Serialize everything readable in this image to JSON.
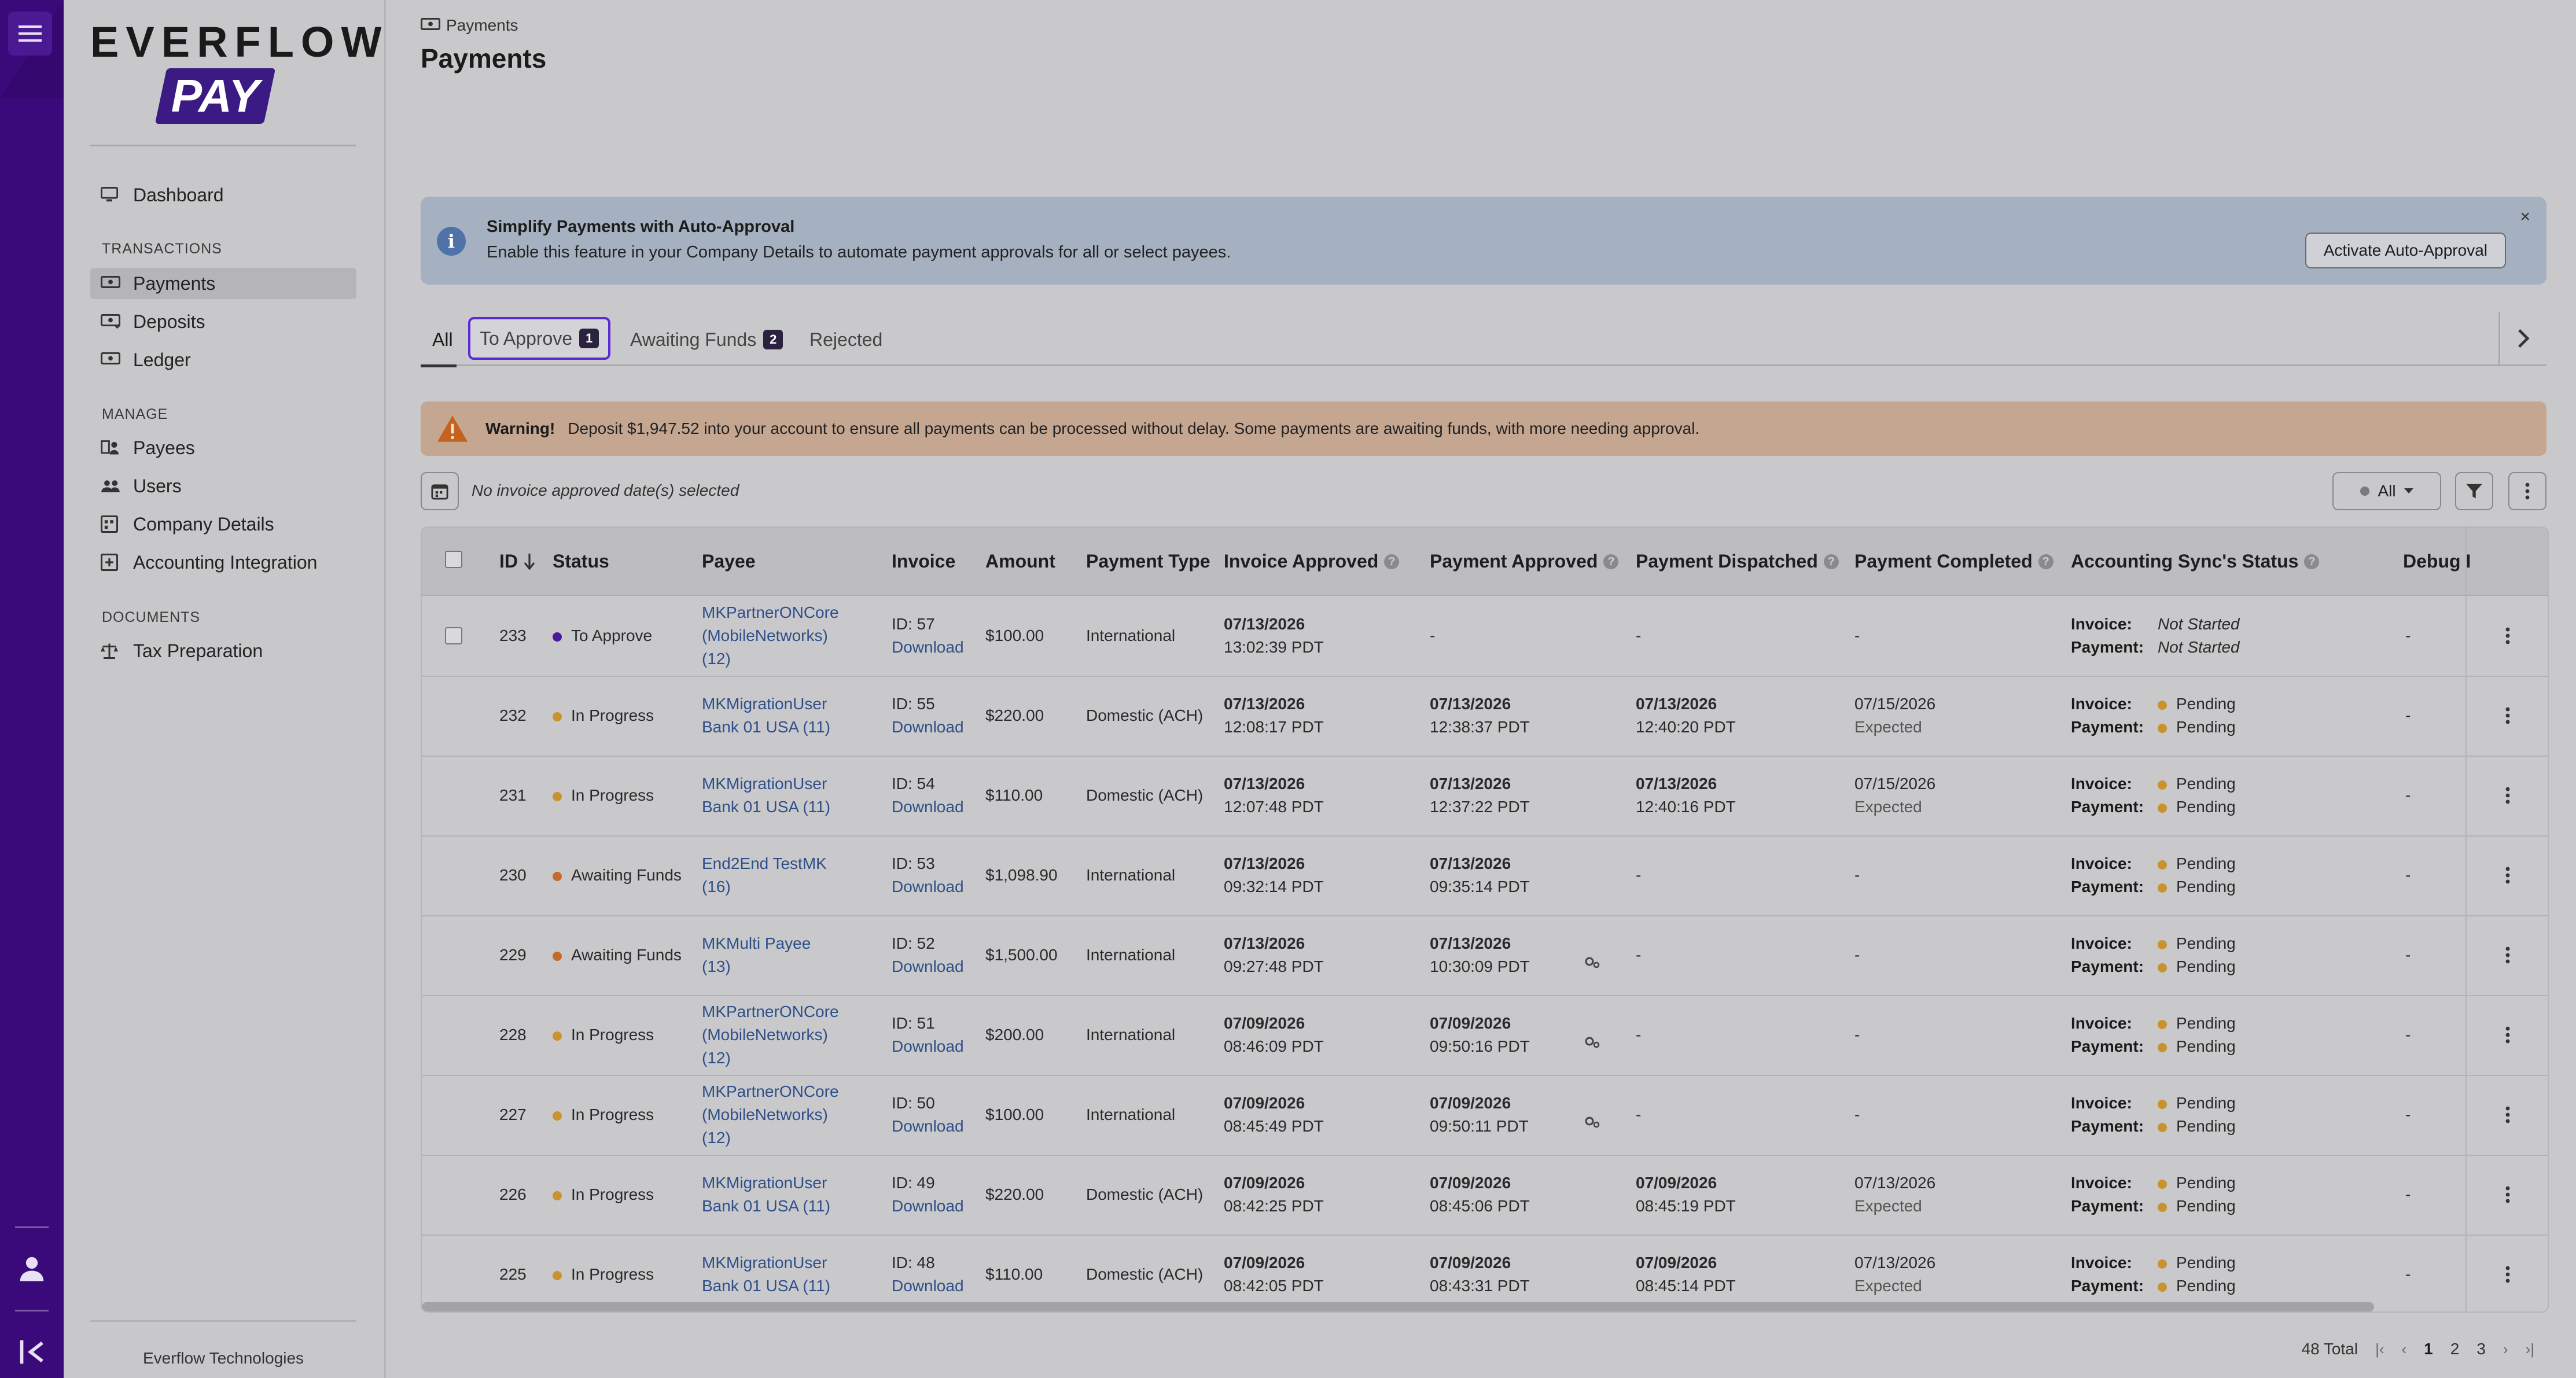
{
  "sidebar": {
    "logo_top": "EVERFLOW",
    "logo_bottom": "PAY",
    "dashboard": "Dashboard",
    "sections": {
      "transactions": "TRANSACTIONS",
      "manage": "MANAGE",
      "documents": "DOCUMENTS"
    },
    "items": {
      "payments": "Payments",
      "deposits": "Deposits",
      "ledger": "Ledger",
      "payees": "Payees",
      "users": "Users",
      "company_details": "Company Details",
      "accounting_integration": "Accounting Integration",
      "tax_preparation": "Tax Preparation"
    },
    "footer": "Everflow Technologies"
  },
  "header": {
    "breadcrumb": "Payments",
    "title": "Payments"
  },
  "banner": {
    "title": "Simplify Payments with Auto-Approval",
    "description": "Enable this feature in your Company Details to automate payment approvals for all or select payees.",
    "button": "Activate Auto-Approval",
    "close": "×"
  },
  "tabs": {
    "all": "All",
    "to_approve": "To Approve",
    "to_approve_count": "1",
    "awaiting_funds": "Awaiting Funds",
    "awaiting_funds_count": "2",
    "rejected": "Rejected"
  },
  "warning": {
    "label": "Warning!",
    "message": "Deposit $1,947.52 into your account to ensure all payments can be processed without delay. Some payments are awaiting funds, with more needing approval."
  },
  "filter": {
    "date_text": "No invoice approved date(s) selected",
    "status_select": "All"
  },
  "colors": {
    "to_approve": "#4a1a9a",
    "in_progress": "#c9922e",
    "awaiting_funds": "#c46a2a",
    "pending": "#c9922e",
    "rail": "#3a0a7a"
  },
  "table": {
    "columns": {
      "id": "ID",
      "status": "Status",
      "payee": "Payee",
      "invoice": "Invoice",
      "amount": "Amount",
      "payment_type": "Payment Type",
      "invoice_approved": "Invoice Approved",
      "payment_approved": "Payment Approved",
      "payment_dispatched": "Payment Dispatched",
      "payment_completed": "Payment Completed",
      "accounting_sync": "Accounting Sync's Status",
      "debug": "Debug I"
    },
    "acc_invoice_label": "Invoice:",
    "acc_payment_label": "Payment:",
    "rows": [
      {
        "id": "233",
        "status": "To Approve",
        "status_key": "to_approve",
        "payee": [
          "MKPartnerONCore",
          "(MobileNetworks)",
          "(12)"
        ],
        "invoice_id": "ID: 57",
        "download": "Download",
        "amount": "$100.00",
        "type": "International",
        "inv_date": "07/13/2026",
        "inv_time": "13:02:39 PDT",
        "pa_date": "-",
        "pa_time": "",
        "pd_date": "-",
        "pd_time": "",
        "pc_date": "-",
        "pc_sub": "",
        "acc_invoice": "Not Started",
        "acc_payment": "Not Started",
        "acc_style": "italic",
        "debug": "-",
        "checkbox": true,
        "gear": false
      },
      {
        "id": "232",
        "status": "In Progress",
        "status_key": "in_progress",
        "payee": [
          "MKMigrationUser",
          "Bank 01 USA (11)"
        ],
        "invoice_id": "ID: 55",
        "download": "Download",
        "amount": "$220.00",
        "type": "Domestic (ACH)",
        "inv_date": "07/13/2026",
        "inv_time": "12:08:17 PDT",
        "pa_date": "07/13/2026",
        "pa_time": "12:38:37 PDT",
        "pd_date": "07/13/2026",
        "pd_time": "12:40:20 PDT",
        "pc_date": "07/15/2026",
        "pc_sub": "Expected",
        "acc_invoice": "Pending",
        "acc_payment": "Pending",
        "acc_style": "dot",
        "debug": "-",
        "checkbox": false,
        "gear": false
      },
      {
        "id": "231",
        "status": "In Progress",
        "status_key": "in_progress",
        "payee": [
          "MKMigrationUser",
          "Bank 01 USA (11)"
        ],
        "invoice_id": "ID: 54",
        "download": "Download",
        "amount": "$110.00",
        "type": "Domestic (ACH)",
        "inv_date": "07/13/2026",
        "inv_time": "12:07:48 PDT",
        "pa_date": "07/13/2026",
        "pa_time": "12:37:22 PDT",
        "pd_date": "07/13/2026",
        "pd_time": "12:40:16 PDT",
        "pc_date": "07/15/2026",
        "pc_sub": "Expected",
        "acc_invoice": "Pending",
        "acc_payment": "Pending",
        "acc_style": "dot",
        "debug": "-",
        "checkbox": false,
        "gear": false
      },
      {
        "id": "230",
        "status": "Awaiting Funds",
        "status_key": "awaiting_funds",
        "payee": [
          "End2End TestMK",
          "(16)"
        ],
        "invoice_id": "ID: 53",
        "download": "Download",
        "amount": "$1,098.90",
        "type": "International",
        "inv_date": "07/13/2026",
        "inv_time": "09:32:14 PDT",
        "pa_date": "07/13/2026",
        "pa_time": "09:35:14 PDT",
        "pd_date": "-",
        "pd_time": "",
        "pc_date": "-",
        "pc_sub": "",
        "acc_invoice": "Pending",
        "acc_payment": "Pending",
        "acc_style": "dot",
        "debug": "-",
        "checkbox": false,
        "gear": false
      },
      {
        "id": "229",
        "status": "Awaiting Funds",
        "status_key": "awaiting_funds",
        "payee": [
          "MKMulti Payee",
          "(13)"
        ],
        "invoice_id": "ID: 52",
        "download": "Download",
        "amount": "$1,500.00",
        "type": "International",
        "inv_date": "07/13/2026",
        "inv_time": "09:27:48 PDT",
        "pa_date": "07/13/2026",
        "pa_time": "10:30:09 PDT",
        "pd_date": "-",
        "pd_time": "",
        "pc_date": "-",
        "pc_sub": "",
        "acc_invoice": "Pending",
        "acc_payment": "Pending",
        "acc_style": "dot",
        "debug": "-",
        "checkbox": false,
        "gear": true
      },
      {
        "id": "228",
        "status": "In Progress",
        "status_key": "in_progress",
        "payee": [
          "MKPartnerONCore",
          "(MobileNetworks)",
          "(12)"
        ],
        "invoice_id": "ID: 51",
        "download": "Download",
        "amount": "$200.00",
        "type": "International",
        "inv_date": "07/09/2026",
        "inv_time": "08:46:09 PDT",
        "pa_date": "07/09/2026",
        "pa_time": "09:50:16 PDT",
        "pd_date": "-",
        "pd_time": "",
        "pc_date": "-",
        "pc_sub": "",
        "acc_invoice": "Pending",
        "acc_payment": "Pending",
        "acc_style": "dot",
        "debug": "-",
        "checkbox": false,
        "gear": true
      },
      {
        "id": "227",
        "status": "In Progress",
        "status_key": "in_progress",
        "payee": [
          "MKPartnerONCore",
          "(MobileNetworks)",
          "(12)"
        ],
        "invoice_id": "ID: 50",
        "download": "Download",
        "amount": "$100.00",
        "type": "International",
        "inv_date": "07/09/2026",
        "inv_time": "08:45:49 PDT",
        "pa_date": "07/09/2026",
        "pa_time": "09:50:11 PDT",
        "pd_date": "-",
        "pd_time": "",
        "pc_date": "-",
        "pc_sub": "",
        "acc_invoice": "Pending",
        "acc_payment": "Pending",
        "acc_style": "dot",
        "debug": "-",
        "checkbox": false,
        "gear": true
      },
      {
        "id": "226",
        "status": "In Progress",
        "status_key": "in_progress",
        "payee": [
          "MKMigrationUser",
          "Bank 01 USA (11)"
        ],
        "invoice_id": "ID: 49",
        "download": "Download",
        "amount": "$220.00",
        "type": "Domestic (ACH)",
        "inv_date": "07/09/2026",
        "inv_time": "08:42:25 PDT",
        "pa_date": "07/09/2026",
        "pa_time": "08:45:06 PDT",
        "pd_date": "07/09/2026",
        "pd_time": "08:45:19 PDT",
        "pc_date": "07/13/2026",
        "pc_sub": "Expected",
        "acc_invoice": "Pending",
        "acc_payment": "Pending",
        "acc_style": "dot",
        "debug": "-",
        "checkbox": false,
        "gear": false
      },
      {
        "id": "225",
        "status": "In Progress",
        "status_key": "in_progress",
        "payee": [
          "MKMigrationUser",
          "Bank 01 USA (11)"
        ],
        "invoice_id": "ID: 48",
        "download": "Download",
        "amount": "$110.00",
        "type": "Domestic (ACH)",
        "inv_date": "07/09/2026",
        "inv_time": "08:42:05 PDT",
        "pa_date": "07/09/2026",
        "pa_time": "08:43:31 PDT",
        "pd_date": "07/09/2026",
        "pd_time": "08:45:14 PDT",
        "pc_date": "07/13/2026",
        "pc_sub": "Expected",
        "acc_invoice": "Pending",
        "acc_payment": "Pending",
        "acc_style": "dot",
        "debug": "-",
        "checkbox": false,
        "gear": false
      }
    ]
  },
  "pagination": {
    "total": "48 Total",
    "pages": [
      "1",
      "2",
      "3"
    ],
    "current": "1"
  }
}
